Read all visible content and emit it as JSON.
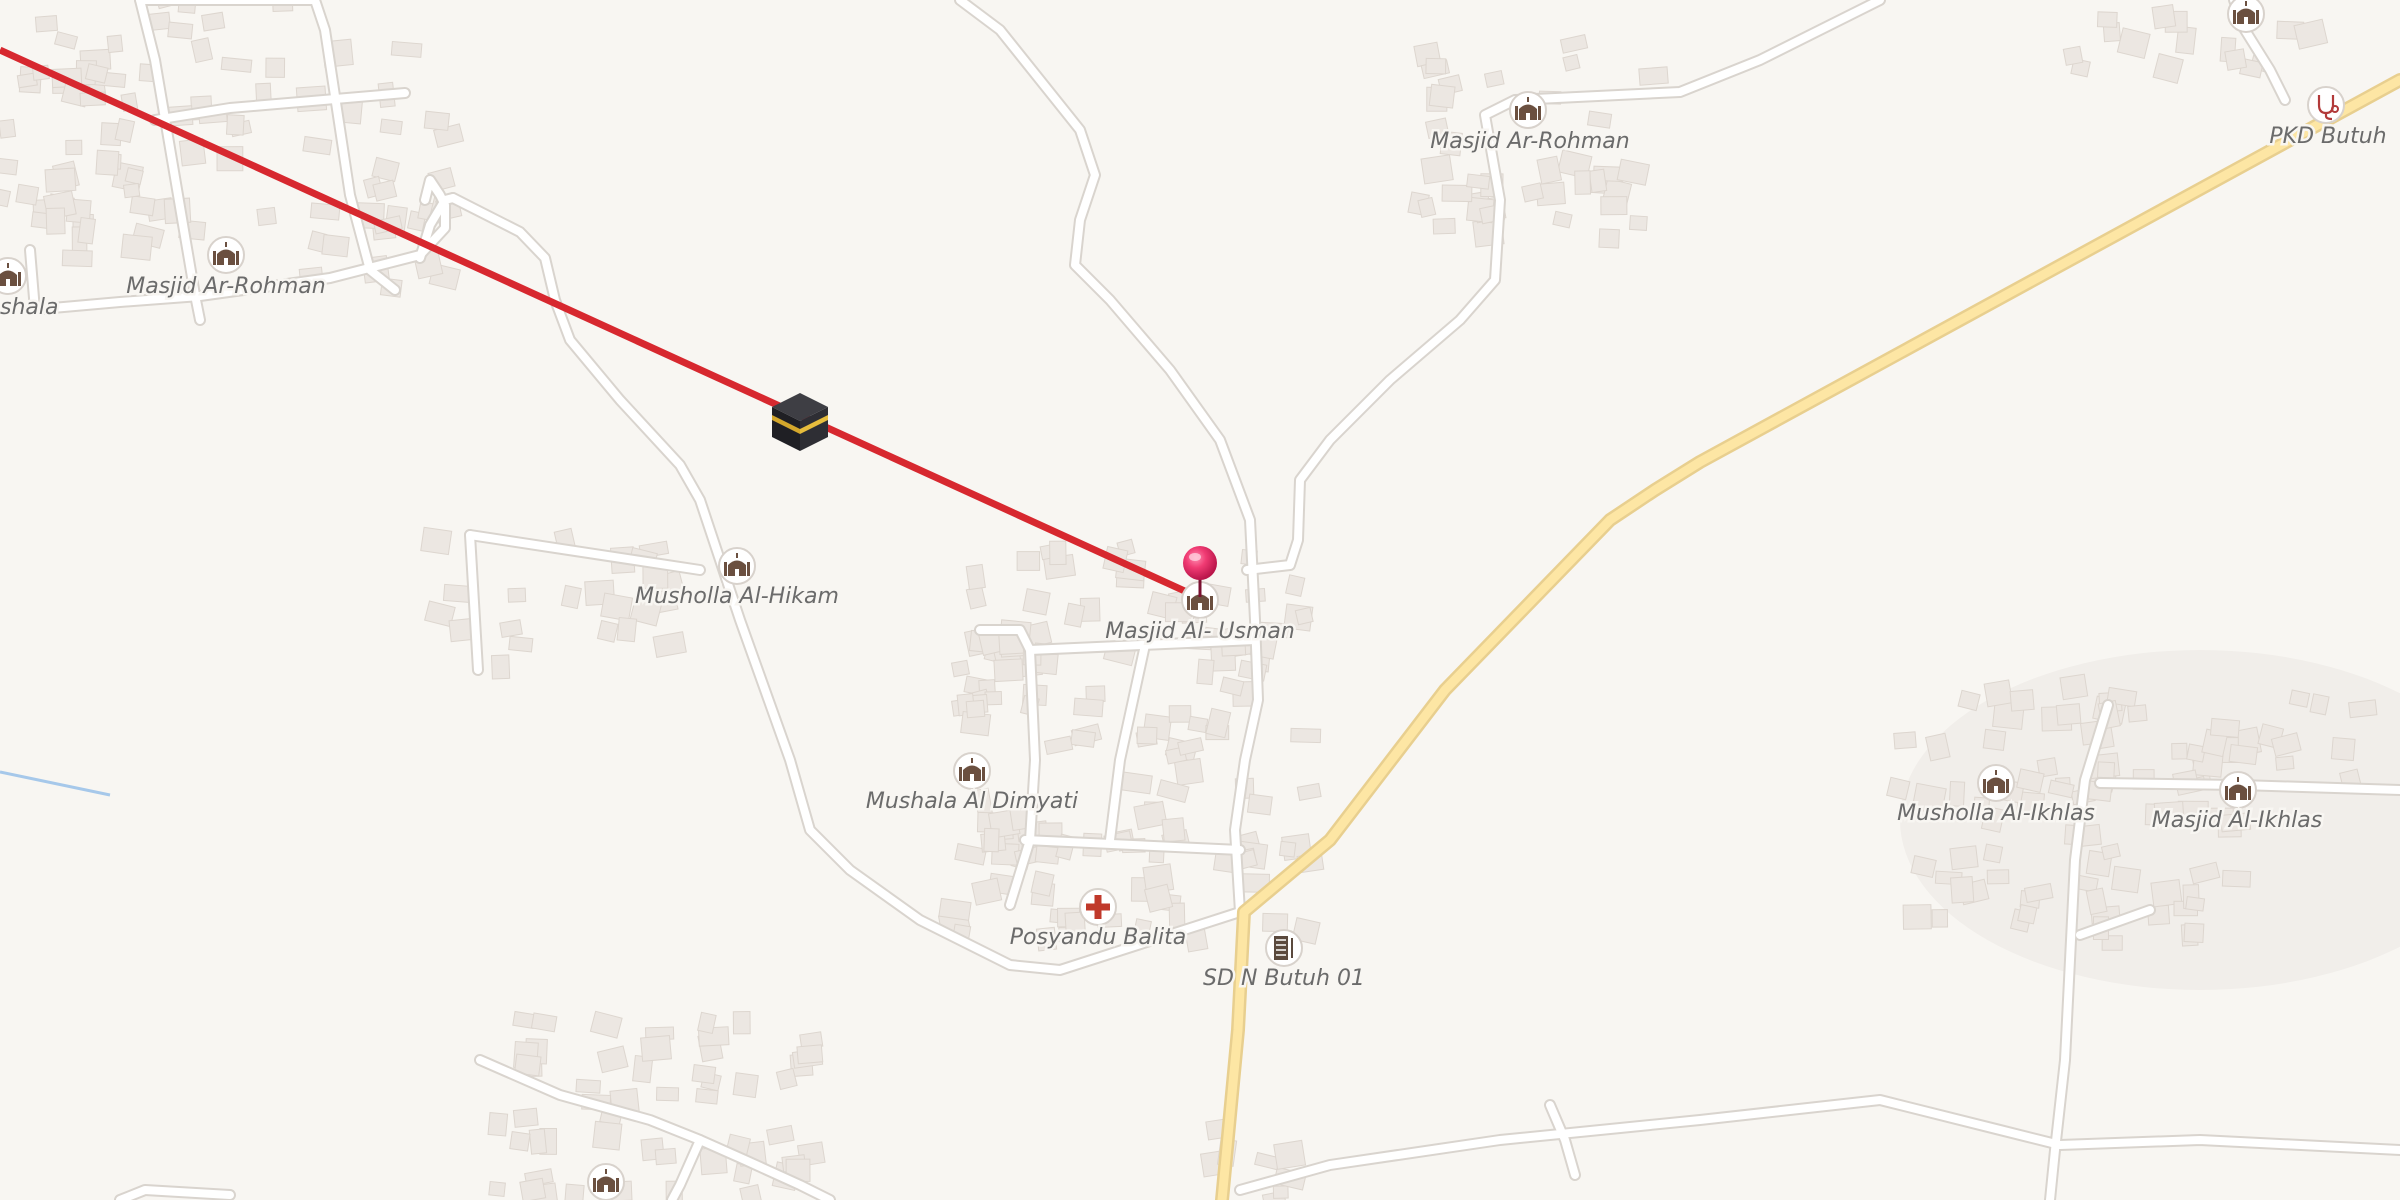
{
  "map": {
    "qibla_icon": "kaaba-icon",
    "qibla_line_color": "#d7282f",
    "marker_icon": "location-pin-icon",
    "marker_color": "#e8245f",
    "poi_labels": [
      "Masjid Ar-Rohman",
      "Masjid Ar-Rohman",
      "PKD Butuh",
      "Musholla Al-Hikam",
      "Masjid Al- Usman",
      "Mushala Al Dimyati",
      "Posyandu Balita",
      "SD N Butuh 01",
      "Musholla Al-Ikhlas",
      "Masjid Al-Ikhlas",
      "shala"
    ]
  }
}
